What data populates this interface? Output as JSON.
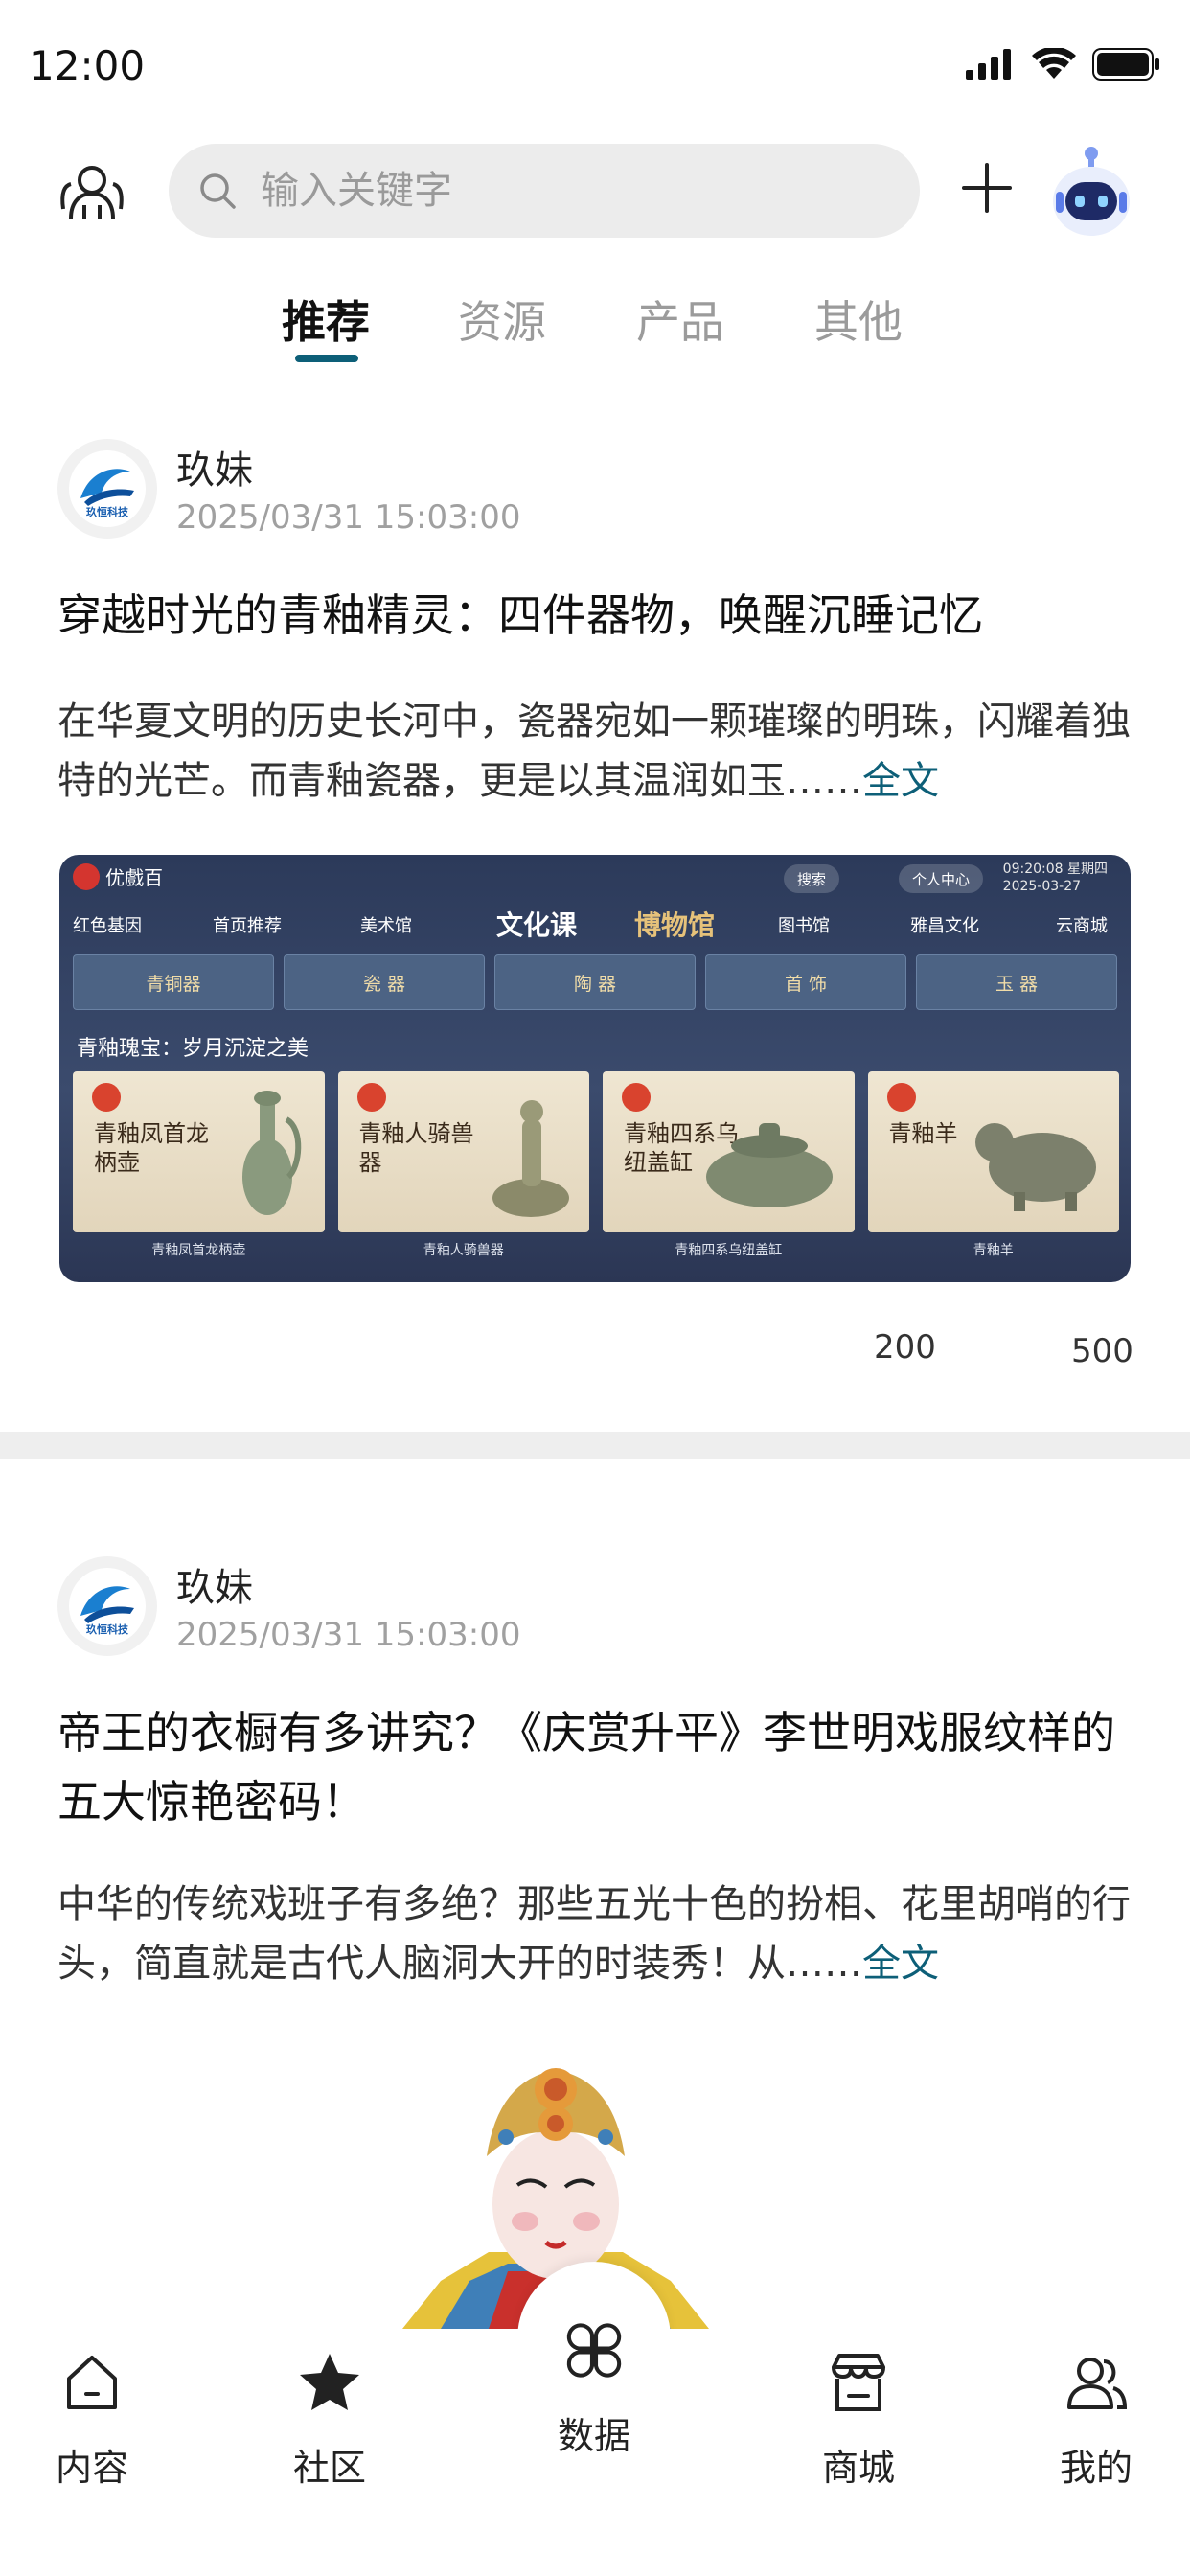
{
  "status_bar": {
    "time": "12:00"
  },
  "header": {
    "search_placeholder": "输入关键字"
  },
  "tabs": [
    {
      "label": "推荐",
      "active": true
    },
    {
      "label": "资源",
      "active": false
    },
    {
      "label": "产品",
      "active": false
    },
    {
      "label": "其他",
      "active": false
    }
  ],
  "posts": [
    {
      "author": "玖妹",
      "avatar_text": "玖恒科技",
      "time": "2025/03/31 15:03:00",
      "title": "穿越时光的青釉精灵：四件器物，唤醒沉睡记忆",
      "summary": "在华夏文明的历史长河中，瓷器宛如一颗璀璨的明珠，闪耀着独特的光芒。而青釉瓷器，更是以其温润如玉……",
      "read_more": "全文",
      "stat_a": "200",
      "stat_b": "500",
      "banner": {
        "brand": "优戲百",
        "search": "搜索",
        "profile": "个人中心",
        "clock_time": "09:20:08 星期四",
        "clock_date": "2025-03-27",
        "nav": [
          "红色基因",
          "首页推荐",
          "美术馆",
          "文化课",
          "博物馆",
          "图书馆",
          "雅昌文化",
          "云商城"
        ],
        "categories": [
          "青铜器",
          "瓷 器",
          "陶 器",
          "首 饰",
          "玉 器"
        ],
        "subtitle": "青釉瑰宝：岁月沉淀之美",
        "cards": [
          {
            "title": "青釉凤首龙柄壶",
            "caption": "青釉凤首龙柄壶"
          },
          {
            "title": "青釉人骑兽器",
            "caption": "青釉人骑兽器"
          },
          {
            "title": "青釉四系乌纽盖缸",
            "caption": "青釉四系乌纽盖缸"
          },
          {
            "title": "青釉羊",
            "caption": "青釉羊"
          }
        ]
      }
    },
    {
      "author": "玖妹",
      "avatar_text": "玖恒科技",
      "time": "2025/03/31 15:03:00",
      "title": "帝王的衣橱有多讲究？《庆赏升平》李世明戏服纹样的五大惊艳密码！",
      "summary": "中华的传统戏班子有多绝？那些五光十色的扮相、花里胡哨的行头，简直就是古代人脑洞大开的时装秀！从……",
      "read_more": "全文"
    }
  ],
  "bottom_nav": [
    {
      "label": "内容",
      "icon": "home-icon"
    },
    {
      "label": "社区",
      "icon": "star-icon"
    },
    {
      "label": "数据",
      "icon": "clover-icon"
    },
    {
      "label": "商城",
      "icon": "store-icon"
    },
    {
      "label": "我的",
      "icon": "people-icon"
    }
  ],
  "colors": {
    "accent": "#0d5f78",
    "divider": "#eeeeee",
    "search_bg": "#ececec"
  }
}
